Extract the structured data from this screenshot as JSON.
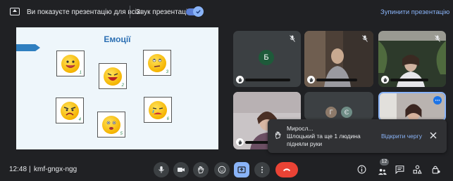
{
  "top_bar": {
    "presenting_text": "Ви показуєте презентацію для всіх",
    "sound_label": "Звук презентації",
    "stop_label": "Зупинити презентацію"
  },
  "slide": {
    "title": "Емоції",
    "cards": [
      "1",
      "2",
      "3",
      "4",
      "5",
      "6"
    ]
  },
  "tiles": {
    "b_initial": "Б",
    "g_initial": "Г",
    "e_initial": "Є"
  },
  "notification": {
    "line1": "Миросл...",
    "line2": "Шлоцький та ще 1 людина",
    "line3": "підняли руки",
    "action": "Відкрити чергу"
  },
  "bottom_bar": {
    "time": "12:48",
    "separator": "|",
    "meeting_code": "kmf-gngx-ngg",
    "participants_count": "12"
  },
  "colors": {
    "accent": "#8ab4f8",
    "end_call": "#ea4335",
    "background": "#202124"
  }
}
